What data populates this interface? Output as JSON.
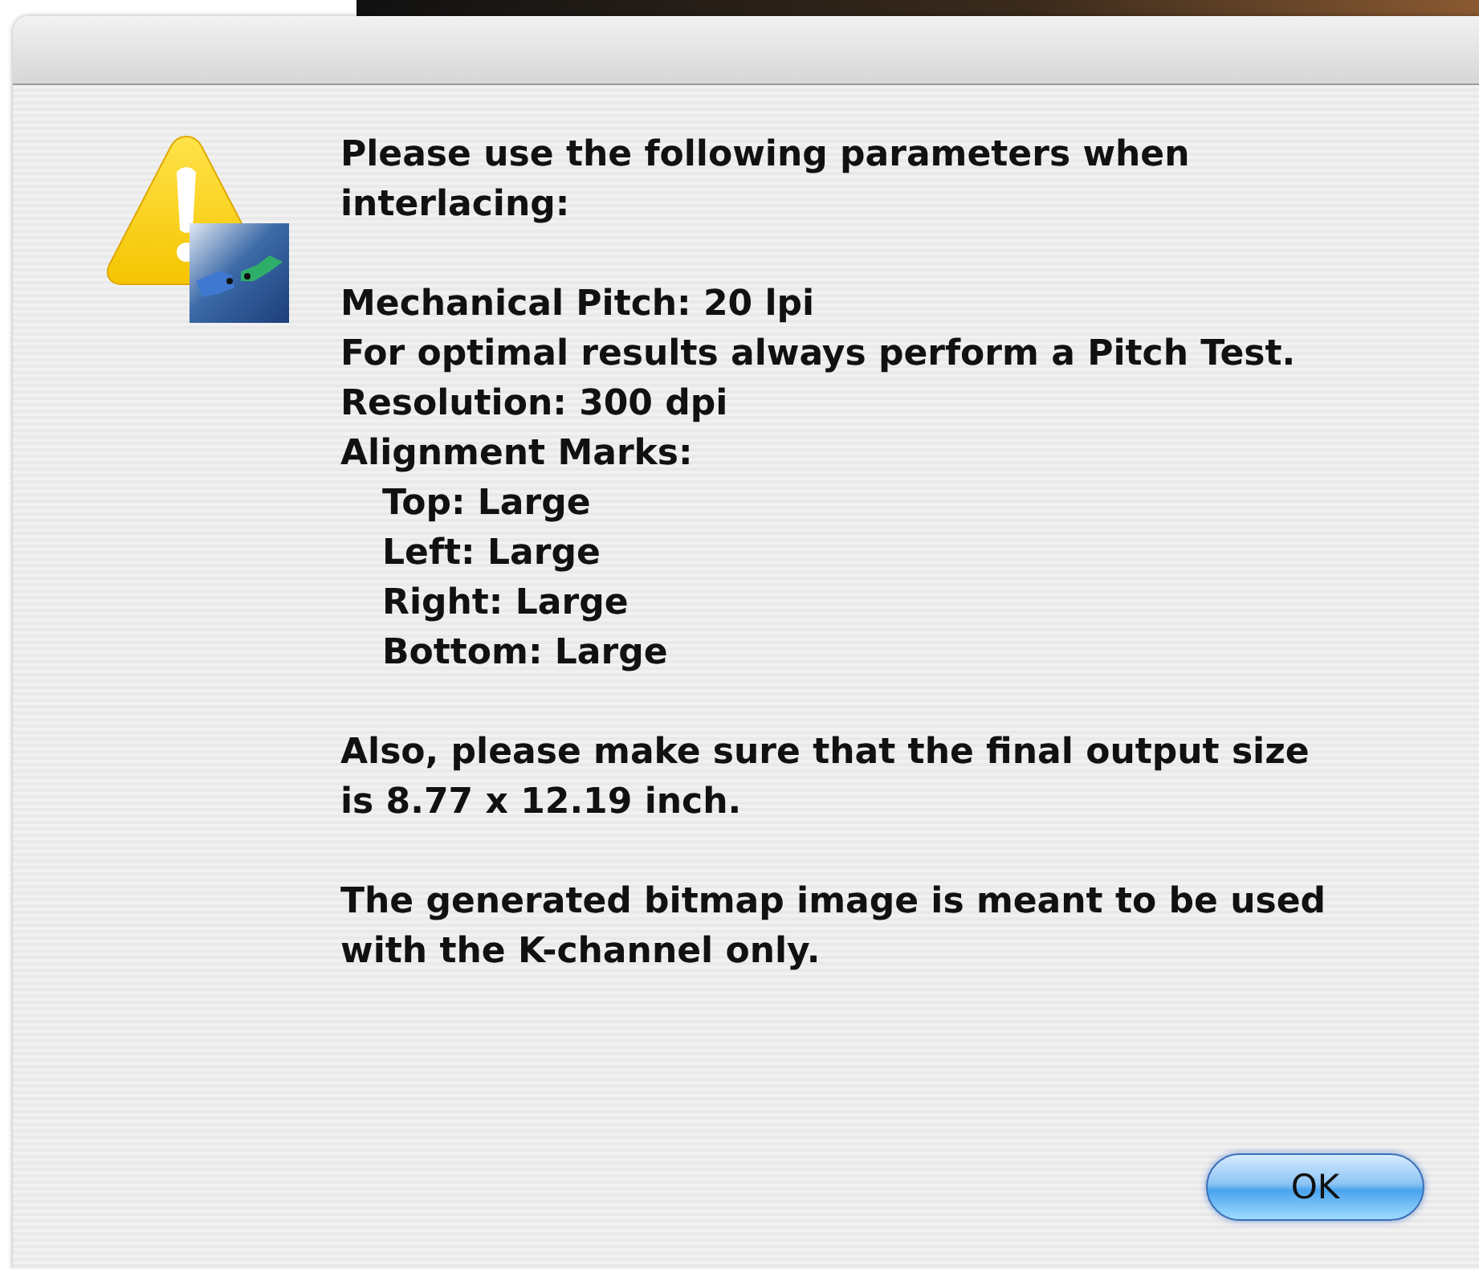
{
  "alert": {
    "paragraphs": [
      {
        "lines": [
          {
            "text": "Please use the following parameters when interlacing:"
          }
        ]
      },
      {
        "lines": [
          {
            "text": "Mechanical Pitch: 20 lpi"
          },
          {
            "text": "For optimal results always perform a Pitch Test."
          },
          {
            "text": "Resolution: 300 dpi"
          },
          {
            "text": "Alignment Marks:",
            "children": [
              {
                "text": "Top: Large"
              },
              {
                "text": "Left: Large"
              },
              {
                "text": "Right: Large"
              },
              {
                "text": "Bottom: Large"
              }
            ]
          }
        ]
      },
      {
        "lines": [
          {
            "text": "Also, please make sure that the final output size is 8.77 x 12.19 inch."
          }
        ]
      },
      {
        "lines": [
          {
            "text": "The generated bitmap image is meant to be used with the K-channel only."
          }
        ]
      }
    ],
    "buttons": [
      {
        "label": "OK",
        "default": true
      }
    ]
  }
}
